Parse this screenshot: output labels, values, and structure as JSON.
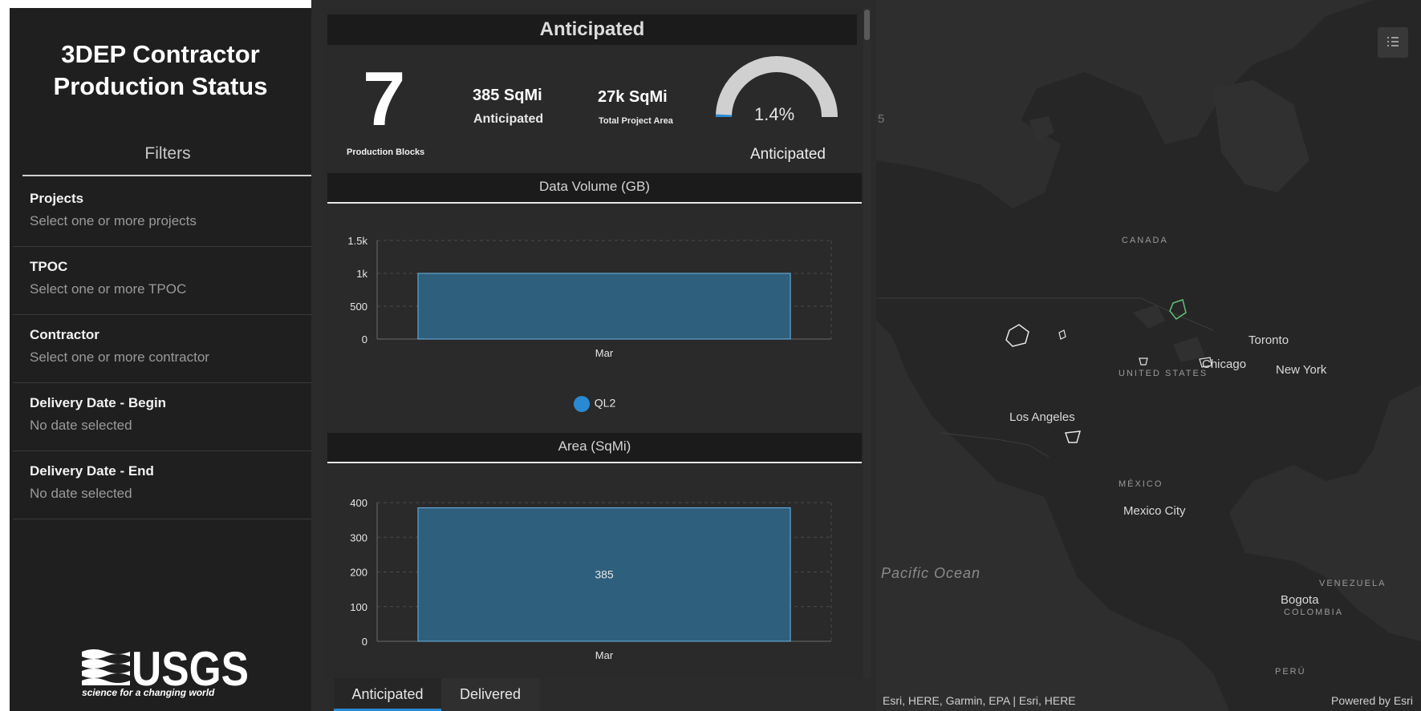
{
  "sidebar": {
    "title_line1": "3DEP Contractor",
    "title_line2": "Production Status",
    "filters_heading": "Filters",
    "filters": [
      {
        "label": "Projects",
        "hint": "Select one or more projects"
      },
      {
        "label": "TPOC",
        "hint": "Select one or more TPOC"
      },
      {
        "label": "Contractor",
        "hint": "Select one or more contractor"
      },
      {
        "label": "Delivery Date - Begin",
        "hint": "No date selected"
      },
      {
        "label": "Delivery Date - End",
        "hint": "No date selected"
      }
    ],
    "logo_text": "USGS",
    "logo_tagline": "science for a changing world"
  },
  "panel": {
    "title": "Anticipated",
    "production_blocks_value": "7",
    "production_blocks_label": "Production Blocks",
    "anticipated_area_value": "385 SqMi",
    "anticipated_area_label": "Anticipated",
    "total_area_value": "27k SqMi",
    "total_area_label": "Total Project Area",
    "gauge_value": "1.4%",
    "gauge_fraction": 0.014,
    "gauge_label": "Anticipated",
    "tabs": [
      {
        "label": "Anticipated",
        "active": true
      },
      {
        "label": "Delivered",
        "active": false
      }
    ]
  },
  "chart_data": [
    {
      "type": "bar",
      "title": "Data Volume (GB)",
      "categories": [
        "Mar"
      ],
      "series": [
        {
          "name": "QL2",
          "values": [
            1000
          ]
        }
      ],
      "yticks": [
        "0",
        "500",
        "1k",
        "1.5k"
      ],
      "ylim": [
        0,
        1500
      ],
      "grid": true,
      "legend": "bottom"
    },
    {
      "type": "bar",
      "title": "Area (SqMi)",
      "categories": [
        "Mar"
      ],
      "values": [
        385
      ],
      "data_labels": [
        "385"
      ],
      "yticks": [
        "0",
        "100",
        "200",
        "300",
        "400"
      ],
      "ylim": [
        0,
        400
      ],
      "grid": true
    }
  ],
  "map": {
    "labels": {
      "canada": "CANADA",
      "united_states": "UNITED STATES",
      "mexico": "MÉXICO",
      "venezuela": "VENEZUELA",
      "colombia": "COLOMBIA",
      "peru": "PERÚ",
      "toronto": "Toronto",
      "chicago": "Chicago",
      "new_york": "New York",
      "los_angeles": "Los Angeles",
      "mexico_city": "Mexico City",
      "bogota": "Bogota",
      "pacific_ocean": "Pacific Ocean",
      "edge_char": "5"
    },
    "attribution": "Esri, HERE, Garmin, EPA | Esri, HERE",
    "powered_by": "Powered by Esri"
  },
  "colors": {
    "bar_fill": "#2e5f7d",
    "bar_stroke": "#6cb6e6",
    "legend_dot": "#2a8ad1",
    "gauge_track": "#d0d0d0",
    "gauge_fill": "#2a8ad1",
    "project_outline": "#5fc27b"
  }
}
